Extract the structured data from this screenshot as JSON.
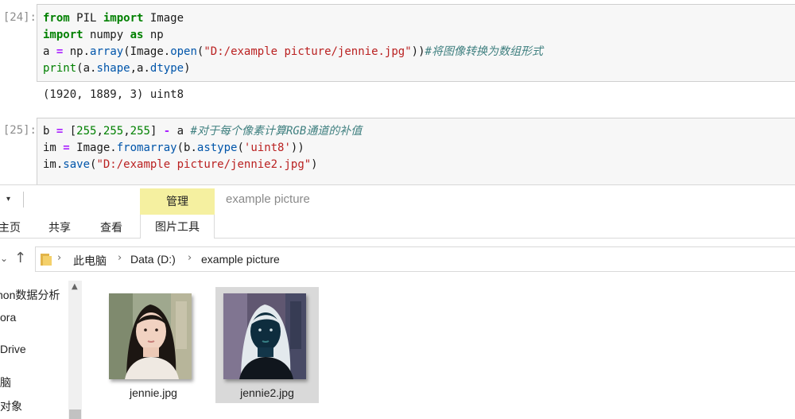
{
  "notebook": {
    "cell1": {
      "prompt": "[24]:",
      "lines": [
        [
          "from",
          " PIL ",
          "import",
          " Image"
        ],
        [
          "import",
          " numpy ",
          "as",
          " np"
        ],
        [
          "a",
          " = ",
          "np.",
          "array",
          "(Image.",
          "open",
          "(",
          "\"D:/example picture/jennie.jpg\"",
          "))",
          "#将图像转换为数组形式"
        ],
        [
          "print",
          "(a.",
          "shape",
          ",a.",
          "dtype",
          ")"
        ]
      ],
      "output": "(1920, 1889, 3) uint8"
    },
    "cell2": {
      "prompt": "[25]:",
      "lines": [
        [
          "b",
          " = ",
          "[",
          "255",
          ",",
          "255",
          ",",
          "255",
          "] ",
          "-",
          " a ",
          "#对于每个像素计算RGB通道的补值"
        ],
        [
          "im",
          " = ",
          "Image.",
          "fromarray",
          "(b.",
          "astype",
          "(",
          "'uint8'",
          "))"
        ],
        [
          "im.",
          "save",
          "(",
          "\"D:/example picture/jennie2.jpg\"",
          ")"
        ]
      ]
    }
  },
  "explorer": {
    "quick_access_arrow": "▾",
    "manage_tab": "管理",
    "window_title": "example picture",
    "ribbon_tabs": [
      "主页",
      "共享",
      "查看",
      "图片工具"
    ],
    "nav_back": "⌄",
    "nav_up": "↑",
    "breadcrumb": [
      "此电脑",
      "Data (D:)",
      "example picture"
    ],
    "breadcrumb_sep": "›",
    "nav_items": [
      "non数据分析",
      "ora",
      "Drive",
      "脑",
      "对象"
    ],
    "scroll_up": "▲",
    "files": [
      {
        "name": "jennie.jpg",
        "selected": false
      },
      {
        "name": "jennie2.jpg",
        "selected": true
      }
    ]
  }
}
